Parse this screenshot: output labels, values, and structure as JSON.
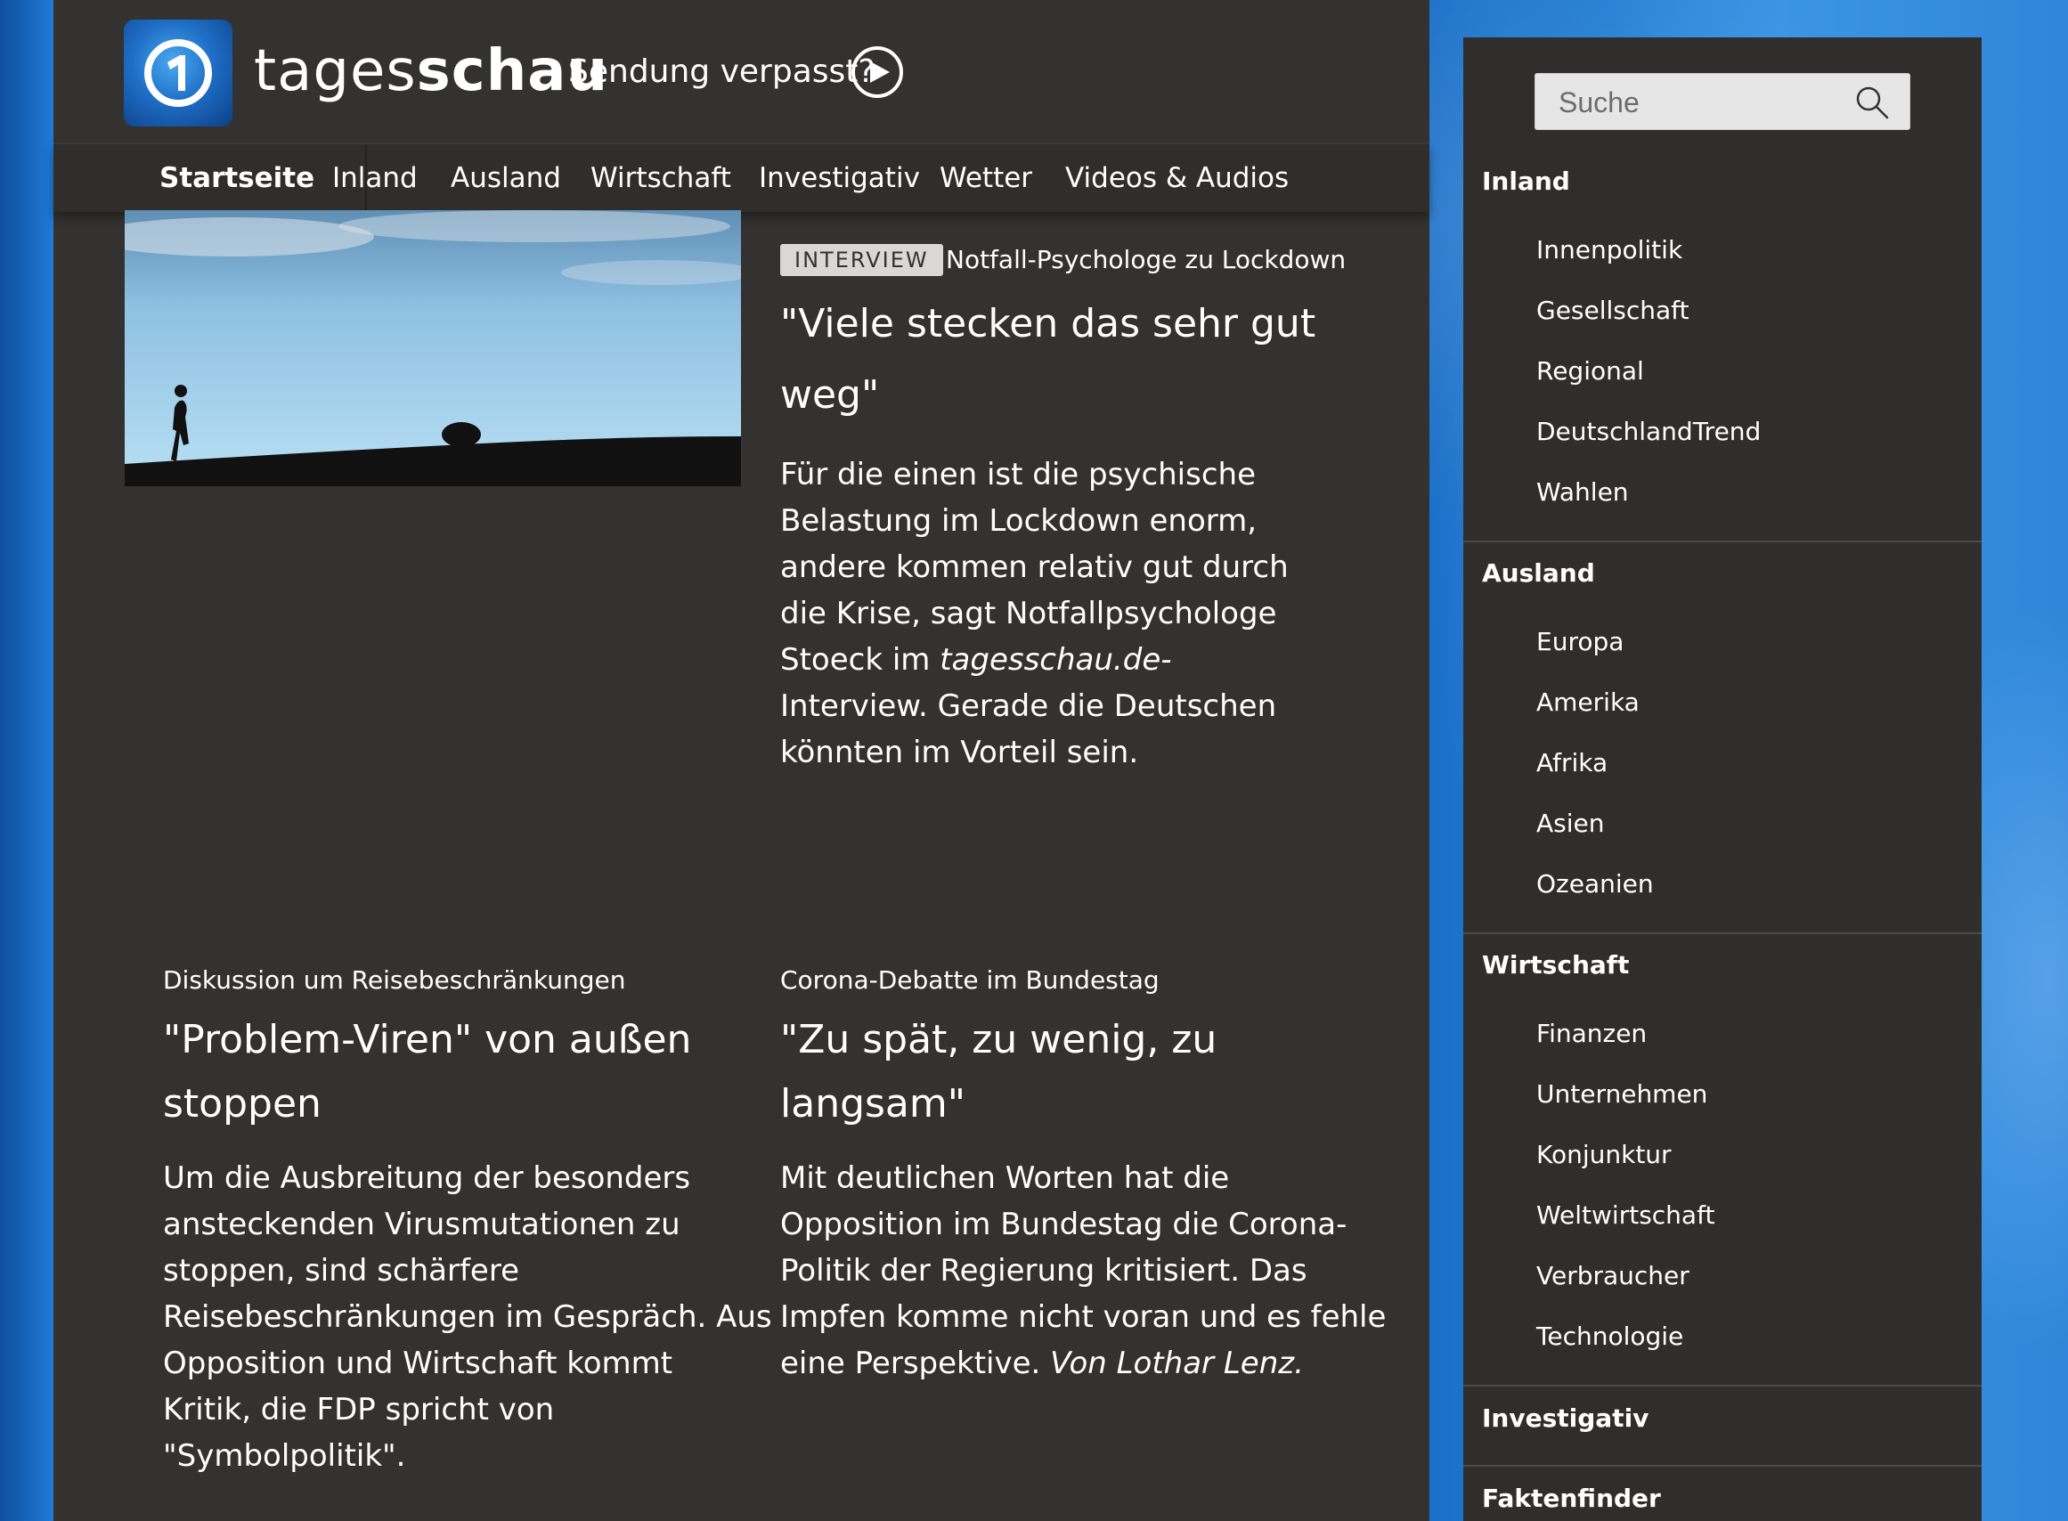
{
  "header": {
    "brand_regular": "tages",
    "brand_bold": "schau",
    "missed_label": "Sendung verpasst?"
  },
  "nav": {
    "items": [
      "Startseite",
      "Inland",
      "Ausland",
      "Wirtschaft",
      "Investigativ",
      "Wetter",
      "Videos & Audios"
    ],
    "active": "Startseite"
  },
  "hero": {
    "tag": "INTERVIEW",
    "topline": "Notfall-Psychologe zu Lockdown",
    "headline_1": "\"Viele stecken das sehr gut",
    "headline_2": "weg\"",
    "teaser_lines": [
      "Für die einen ist die psychische",
      "Belastung im Lockdown enorm,",
      "andere kommen relativ gut durch",
      "die Krise, sagt Notfallpsychologe",
      "Stoeck im ",
      "Interview. Gerade die Deutschen",
      "könnten im Vorteil sein."
    ],
    "teaser_italic": "tagesschau.de-"
  },
  "article_left": {
    "topline": "Diskussion um Reisebeschränkungen",
    "headline_1": "\"Problem-Viren\" von außen",
    "headline_2": "stoppen",
    "teaser_lines": [
      "Um die Ausbreitung der besonders",
      "ansteckenden Virusmutationen zu",
      "stoppen, sind schärfere",
      "Reisebeschränkungen im Gespräch. Aus",
      "Opposition und Wirtschaft kommt",
      "Kritik, die FDP spricht von",
      "\"Symbolpolitik\"."
    ]
  },
  "article_right": {
    "topline": "Corona-Debatte im Bundestag",
    "headline_1": "\"Zu spät, zu wenig, zu",
    "headline_2": "langsam\"",
    "teaser_lines": [
      "Mit deutlichen Worten hat die",
      "Opposition im Bundestag die Corona-",
      "Politik der Regierung kritisiert. Das",
      "Impfen komme nicht voran und es fehle",
      "eine Perspektive. "
    ],
    "teaser_italic": "Von Lothar Lenz."
  },
  "sidebar": {
    "search_placeholder": "Suche",
    "sections": [
      {
        "title": "Inland",
        "items": [
          "Innenpolitik",
          "Gesellschaft",
          "Regional",
          "DeutschlandTrend",
          "Wahlen"
        ]
      },
      {
        "title": "Ausland",
        "items": [
          "Europa",
          "Amerika",
          "Afrika",
          "Asien",
          "Ozeanien"
        ]
      },
      {
        "title": "Wirtschaft",
        "items": [
          "Finanzen",
          "Unternehmen",
          "Konjunktur",
          "Weltwirtschaft",
          "Verbraucher",
          "Technologie"
        ]
      },
      {
        "title": "Investigativ",
        "items": []
      },
      {
        "title": "Faktenfinder",
        "items": []
      }
    ]
  },
  "colors": {
    "page_bg": "#333230",
    "nav_bg": "#2f2e2c",
    "tag_bg": "#d9d8d6",
    "text": "#ffffff",
    "accent_blue": "#1f6fc7"
  }
}
